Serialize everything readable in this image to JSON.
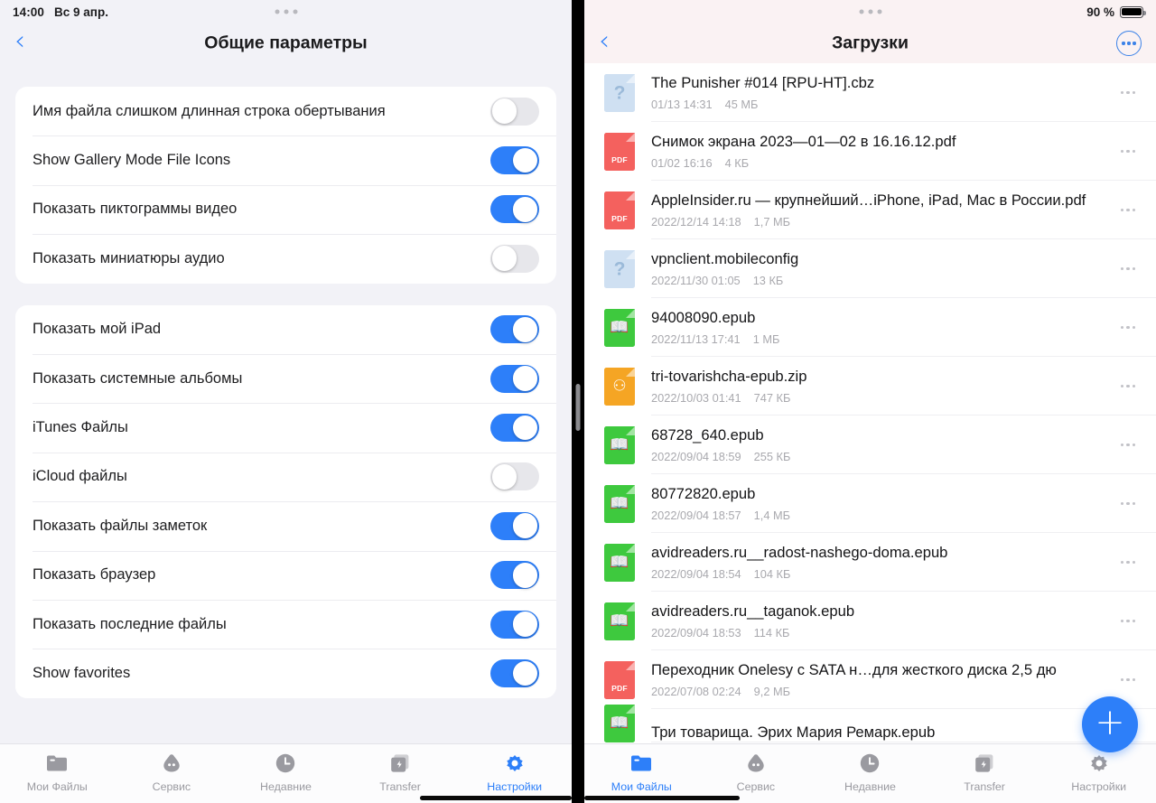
{
  "colors": {
    "accent": "#2d7ff9",
    "toggle_off": "#e7e7eb",
    "pdf": "#f4615e",
    "epub": "#3ec93e",
    "zip": "#f5a524",
    "unknown": "#cfe0f2",
    "tab_inactive": "#9a9aa0"
  },
  "left_panel": {
    "status": {
      "time": "14:00",
      "date": "Вс 9 апр."
    },
    "nav": {
      "back_icon": "chevron-left-icon",
      "title": "Общие параметры"
    },
    "groups": [
      {
        "rows": [
          {
            "label": "Имя файла слишком длинная строка обертывания",
            "state": "off"
          },
          {
            "label": "Show Gallery Mode File Icons",
            "state": "on"
          },
          {
            "label": "Показать пиктограммы видео",
            "state": "on"
          },
          {
            "label": "Показать миниатюры аудио",
            "state": "off"
          }
        ]
      },
      {
        "rows": [
          {
            "label": "Показать мой iPad",
            "state": "on"
          },
          {
            "label": "Показать системные альбомы",
            "state": "on"
          },
          {
            "label": "iTunes Файлы",
            "state": "on"
          },
          {
            "label": "iCloud файлы",
            "state": "off"
          },
          {
            "label": "Показать файлы заметок",
            "state": "on"
          },
          {
            "label": "Показать браузер",
            "state": "on"
          },
          {
            "label": "Показать последние файлы",
            "state": "on"
          },
          {
            "label": "Show favorites",
            "state": "on"
          }
        ]
      }
    ],
    "tabs": [
      {
        "label": "Мои Файлы",
        "icon": "folder-icon",
        "active": false
      },
      {
        "label": "Сервис",
        "icon": "cloud-icon",
        "active": false
      },
      {
        "label": "Недавние",
        "icon": "clock-icon",
        "active": false
      },
      {
        "label": "Transfer",
        "icon": "transfer-icon",
        "active": false
      },
      {
        "label": "Настройки",
        "icon": "gear-icon",
        "active": true
      }
    ]
  },
  "right_panel": {
    "status": {
      "dots": "three-dots-indicator",
      "battery_text": "90 %",
      "battery_icon": "battery-icon"
    },
    "nav": {
      "back_icon": "chevron-left-icon",
      "title": "Загрузки",
      "more_icon": "more-circle-icon"
    },
    "files": [
      {
        "name": "The Punisher #014 [RPU-HT].cbz",
        "date": "01/13 14:31",
        "size": "45 МБ",
        "kind": "unk",
        "badge": "?"
      },
      {
        "name": "Снимок экрана 2023—01—02 в 16.16.12.pdf",
        "date": "01/02 16:16",
        "size": "4 КБ",
        "kind": "pdf",
        "badge": "PDF"
      },
      {
        "name": "AppleInsider.ru — крупнейший…iPhone, iPad, Mac в России.pdf",
        "date": "2022/12/14 14:18",
        "size": "1,7 МБ",
        "kind": "pdf",
        "badge": "PDF"
      },
      {
        "name": "vpnclient.mobileconfig",
        "date": "2022/11/30 01:05",
        "size": "13 КБ",
        "kind": "unk",
        "badge": "?"
      },
      {
        "name": "94008090.epub",
        "date": "2022/11/13 17:41",
        "size": "1 МБ",
        "kind": "epub",
        "badge": "book"
      },
      {
        "name": "tri-tovarishcha-epub.zip",
        "date": "2022/10/03 01:41",
        "size": "747 КБ",
        "kind": "zip",
        "badge": "zip"
      },
      {
        "name": "68728_640.epub",
        "date": "2022/09/04 18:59",
        "size": "255 КБ",
        "kind": "epub",
        "badge": "book"
      },
      {
        "name": "80772820.epub",
        "date": "2022/09/04 18:57",
        "size": "1,4 МБ",
        "kind": "epub",
        "badge": "book"
      },
      {
        "name": "avidreaders.ru__radost-nashego-doma.epub",
        "date": "2022/09/04 18:54",
        "size": "104 КБ",
        "kind": "epub",
        "badge": "book"
      },
      {
        "name": "avidreaders.ru__taganok.epub",
        "date": "2022/09/04 18:53",
        "size": "114 КБ",
        "kind": "epub",
        "badge": "book"
      },
      {
        "name": "Переходник Onelesy с SATA н…для жесткого диска 2,5 дю",
        "date": "2022/07/08 02:24",
        "size": "9,2 МБ",
        "kind": "pdf",
        "badge": "PDF"
      },
      {
        "name": "Три товарища. Эрих Мария Ремарк.epub",
        "date": "",
        "size": "",
        "kind": "epub",
        "badge": "book"
      }
    ],
    "fab": {
      "label": "+",
      "icon": "plus-icon"
    },
    "tabs": [
      {
        "label": "Мои Файлы",
        "icon": "folder-icon",
        "active": true
      },
      {
        "label": "Сервис",
        "icon": "cloud-icon",
        "active": false
      },
      {
        "label": "Недавние",
        "icon": "clock-icon",
        "active": false
      },
      {
        "label": "Transfer",
        "icon": "transfer-icon",
        "active": false
      },
      {
        "label": "Настройки",
        "icon": "gear-icon",
        "active": false
      }
    ]
  }
}
